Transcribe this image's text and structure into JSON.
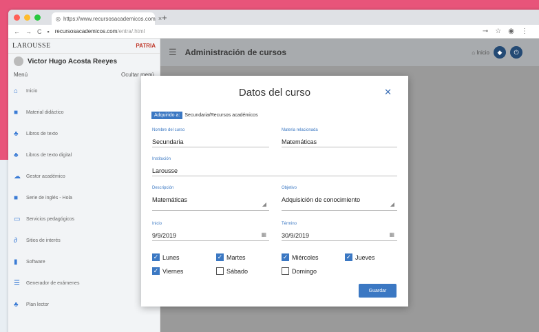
{
  "browser": {
    "tab_title": "https://www.recursosacademicos.com",
    "url": "recursosacademicos.com",
    "url_rest": "/entra/.html"
  },
  "brand": {
    "left": "LAROUSSE",
    "right": "PATRIA"
  },
  "user": {
    "name": "Victor Hugo Acosta Reeyes"
  },
  "menu": {
    "label": "Menú",
    "hide": "Ocultar menú"
  },
  "sidebar": {
    "items": [
      {
        "label": "Inicio",
        "icon": "home-icon",
        "glyph": "⌂"
      },
      {
        "label": "Material didáctico",
        "icon": "book-icon",
        "glyph": "■"
      },
      {
        "label": "Libros de texto",
        "icon": "users-icon",
        "glyph": "♣"
      },
      {
        "label": "Libros de texto digital",
        "icon": "users-icon",
        "glyph": "♣"
      },
      {
        "label": "Gestor académico",
        "icon": "cloud-icon",
        "glyph": "☁"
      },
      {
        "label": "Serie de inglés - Hola",
        "icon": "book-icon",
        "glyph": "■"
      },
      {
        "label": "Servicios pedagógicos",
        "icon": "chat-icon",
        "glyph": "▭"
      },
      {
        "label": "Sitios de interés",
        "icon": "link-icon",
        "glyph": "∂"
      },
      {
        "label": "Software",
        "icon": "file-icon",
        "glyph": "▮"
      },
      {
        "label": "Generador de exámenes",
        "icon": "list-icon",
        "glyph": "☰"
      },
      {
        "label": "Plan lector",
        "icon": "users-icon",
        "glyph": "♣"
      }
    ]
  },
  "topbar": {
    "title": "Administración de cursos",
    "inicio": "Inicio"
  },
  "modal": {
    "title": "Datos del curso",
    "close": "✕",
    "tag": "Adquirido a:",
    "tag_value": "Secundaria/Recursos académicos",
    "fields": {
      "nombre": {
        "label": "Nombre del curso",
        "value": "Secundaria"
      },
      "materia": {
        "label": "Materia relacionada",
        "value": "Matemáticas"
      },
      "institucion": {
        "label": "Institución",
        "value": "Larousse"
      },
      "descripcion": {
        "label": "Descripción",
        "value": "Matemáticas"
      },
      "objetivo": {
        "label": "Objetivo",
        "value": "Adquisición de conocimiento"
      },
      "inicio": {
        "label": "Inicio",
        "value": "9/9/2019"
      },
      "termino": {
        "label": "Término",
        "value": "30/9/2019"
      }
    },
    "days": [
      {
        "label": "Lunes",
        "checked": true
      },
      {
        "label": "Martes",
        "checked": true
      },
      {
        "label": "Miércoles",
        "checked": true
      },
      {
        "label": "Jueves",
        "checked": true
      },
      {
        "label": "Viernes",
        "checked": true
      },
      {
        "label": "Sábado",
        "checked": false
      },
      {
        "label": "Domingo",
        "checked": false
      }
    ],
    "save": "Guardar"
  },
  "colors": {
    "accent": "#3b78c3",
    "pink": "#e8547a",
    "dark_button": "#244a74"
  }
}
